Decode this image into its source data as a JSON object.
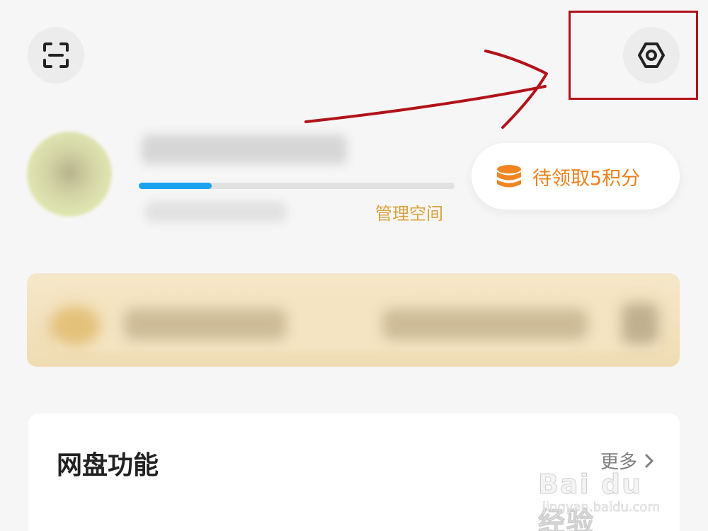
{
  "header": {
    "scan_icon": "scan-icon",
    "settings_icon": "settings-hexagon-icon"
  },
  "profile": {
    "storage_progress": 0.23,
    "manage_space_label": "管理空间"
  },
  "points": {
    "icon": "coin-stack-icon",
    "label": "待领取5积分",
    "accent_color": "#ee7f1a"
  },
  "features": {
    "title": "网盘功能",
    "more_label": "更多",
    "more_icon": "chevron-right-icon"
  },
  "watermark": {
    "brand": "Bai du 经验",
    "url": "jingyan.baidu.com"
  },
  "colors": {
    "progress": "#1aa3ee",
    "manage_link": "#d9a23c",
    "annotation": "#b3121a"
  }
}
